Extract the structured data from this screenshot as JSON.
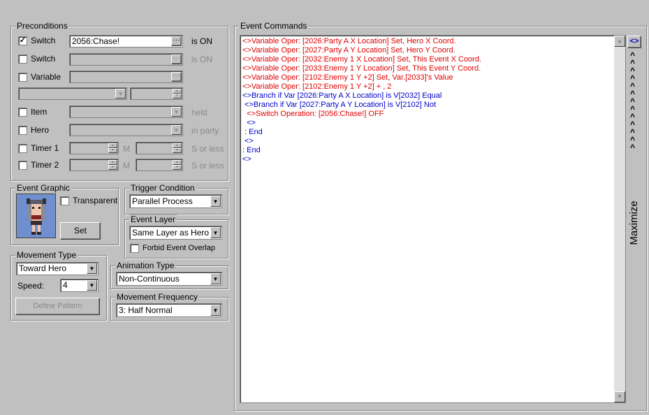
{
  "preconditions": {
    "title": "Preconditions",
    "switch1": {
      "label": "Switch",
      "checked": "✓",
      "value": "2056:Chase!",
      "suffix": "is ON"
    },
    "switch2": {
      "label": "Switch",
      "suffix": "is ON"
    },
    "variable": {
      "label": "Variable"
    },
    "item": {
      "label": "Item",
      "suffix": "held"
    },
    "hero": {
      "label": "Hero",
      "suffix": "in party"
    },
    "timer1": {
      "label": "Timer 1",
      "m": "M",
      "s": "S or less"
    },
    "timer2": {
      "label": "Timer 2",
      "m": "M",
      "s": "S or less"
    },
    "browse": "···"
  },
  "event_graphic": {
    "title": "Event Graphic",
    "transparent_label": "Transparent",
    "set_button": "Set"
  },
  "trigger": {
    "title": "Trigger Condition",
    "value": "Parallel Process"
  },
  "event_layer": {
    "title": "Event Layer",
    "value": "Same Layer as Hero",
    "forbid_label": "Forbid Event Overlap"
  },
  "movement_type": {
    "title": "Movement Type",
    "value": "Toward Hero",
    "speed_label": "Speed:",
    "speed_value": "4",
    "define_pattern": "Define Pattern"
  },
  "animation_type": {
    "title": "Animation Type",
    "value": "Non-Continuous"
  },
  "movement_frequency": {
    "title": "Movement Frequency",
    "value": "3: Half Normal"
  },
  "event_commands": {
    "title": "Event Commands",
    "lines": [
      {
        "text": "<>Variable Oper: [2026:Party A X Location] Set, Hero X Coord.",
        "color": "red"
      },
      {
        "text": "<>Variable Oper: [2027:Party A Y Location] Set, Hero Y Coord.",
        "color": "red"
      },
      {
        "text": "<>Variable Oper: [2032:Enemy 1 X Location] Set, This Event X Coord.",
        "color": "red"
      },
      {
        "text": "<>Variable Oper: [2033:Enemy 1 Y Location] Set, This Event Y Coord.",
        "color": "red"
      },
      {
        "text": "<>Variable Oper: [2102:Enemy 1 Y +2] Set, Var.[2033]'s Value",
        "color": "red"
      },
      {
        "text": "<>Variable Oper: [2102:Enemy 1 Y +2] + , 2",
        "color": "red"
      },
      {
        "text": "<>Branch if Var [2026:Party A X Location] is V[2032] Equal",
        "color": "blue"
      },
      {
        "text": " <>Branch if Var [2027:Party A Y Location] is V[2102] Not",
        "color": "blue"
      },
      {
        "text": "  <>Switch Operation: [2056:Chase!] OFF",
        "color": "red"
      },
      {
        "text": "  <>",
        "color": "blue"
      },
      {
        "text": " : End",
        "color": "blue"
      },
      {
        "text": " <>",
        "color": "blue"
      },
      {
        "text": ": End",
        "color": "blue"
      },
      {
        "text": "<>",
        "color": "blue"
      }
    ]
  },
  "maximize": {
    "label": "Maximize",
    "chevrons": "^^^^^^^^^^^^^",
    "toggle": "<>"
  },
  "icons": {
    "dropdown": "▼",
    "spin_up": "▲",
    "spin_down": "▼",
    "scroll_up": "▲",
    "scroll_down": "▼"
  }
}
